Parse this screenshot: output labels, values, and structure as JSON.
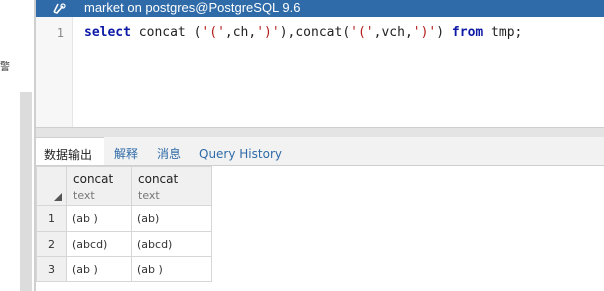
{
  "editor": {
    "title": "market on postgres@PostgreSQL 9.6",
    "line_number": "1",
    "code": {
      "kw_select": "select",
      "part1": " concat (",
      "str1": "'('",
      "part2": ",ch,",
      "str2": "')'",
      "part3": "),concat(",
      "str3": "'('",
      "part4": ",vch,",
      "str4": "')'",
      "part5": ") ",
      "kw_from": "from",
      "part6": " tmp;"
    }
  },
  "left_panel": {
    "glyph": "警"
  },
  "tabs": [
    {
      "label": "数据输出"
    },
    {
      "label": "解释"
    },
    {
      "label": "消息"
    },
    {
      "label": "Query History"
    }
  ],
  "grid": {
    "columns": [
      {
        "name": "concat",
        "type": "text"
      },
      {
        "name": "concat",
        "type": "text"
      }
    ],
    "rows": [
      {
        "num": "1",
        "cells": [
          "(ab )",
          "(ab)"
        ]
      },
      {
        "num": "2",
        "cells": [
          "(abcd)",
          "(abcd)"
        ]
      },
      {
        "num": "3",
        "cells": [
          "(ab )",
          "(ab )"
        ]
      }
    ]
  },
  "colors": {
    "accent": "#2f6ba8",
    "keyword": "#0d1aa6",
    "string": "#b31a1a"
  }
}
